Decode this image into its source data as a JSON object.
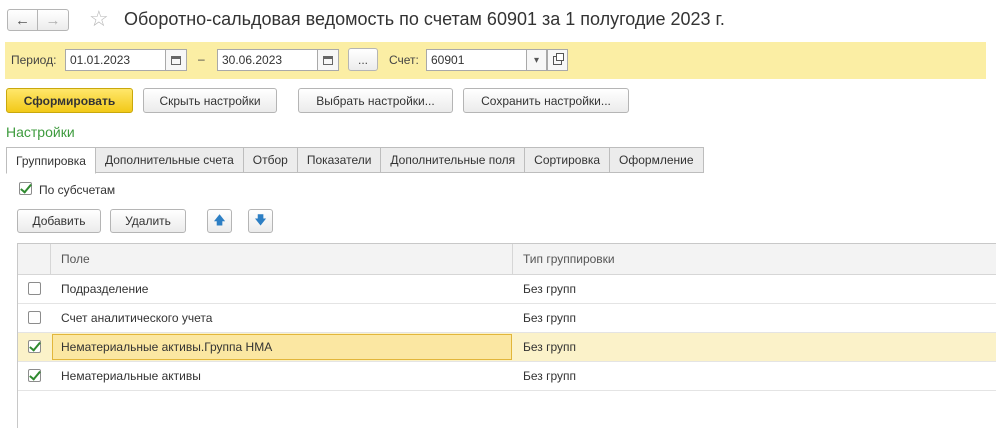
{
  "window": {
    "title": "Оборотно-сальдовая ведомость по счетам 60901 за 1 полугодие 2023 г.",
    "back_icon": "←",
    "forward_icon": "→",
    "star_icon": "☆"
  },
  "period": {
    "label": "Период:",
    "start": "01.01.2023",
    "dash": "–",
    "end": "30.06.2023",
    "dots": "...",
    "account_label": "Счет:",
    "account": "60901",
    "dropdown_icon": "▾"
  },
  "toolbar": {
    "generate": "Сформировать",
    "hide_settings": "Скрыть настройки",
    "choose_settings": "Выбрать настройки...",
    "save_settings": "Сохранить настройки..."
  },
  "settings": {
    "title": "Настройки",
    "tabs": [
      {
        "label": "Группировка",
        "active": true
      },
      {
        "label": "Дополнительные счета",
        "active": false
      },
      {
        "label": "Отбор",
        "active": false
      },
      {
        "label": "Показатели",
        "active": false
      },
      {
        "label": "Дополнительные поля",
        "active": false
      },
      {
        "label": "Сортировка",
        "active": false
      },
      {
        "label": "Оформление",
        "active": false
      }
    ],
    "by_subaccounts": {
      "label": "По субсчетам",
      "checked": true
    },
    "add": "Добавить",
    "delete": "Удалить",
    "up_icon": "🡅",
    "down_icon": "🡇"
  },
  "table": {
    "columns": [
      "Поле",
      "Тип группировки"
    ],
    "rows": [
      {
        "checked": false,
        "field": "Подразделение",
        "type": "Без групп"
      },
      {
        "checked": false,
        "field": "Счет аналитического учета",
        "type": "Без групп"
      },
      {
        "checked": true,
        "field": "Нематериальные активы.Группа НМА",
        "type": "Без групп",
        "selected": true
      },
      {
        "checked": true,
        "field": "Нематериальные активы",
        "type": "Без групп"
      }
    ]
  }
}
